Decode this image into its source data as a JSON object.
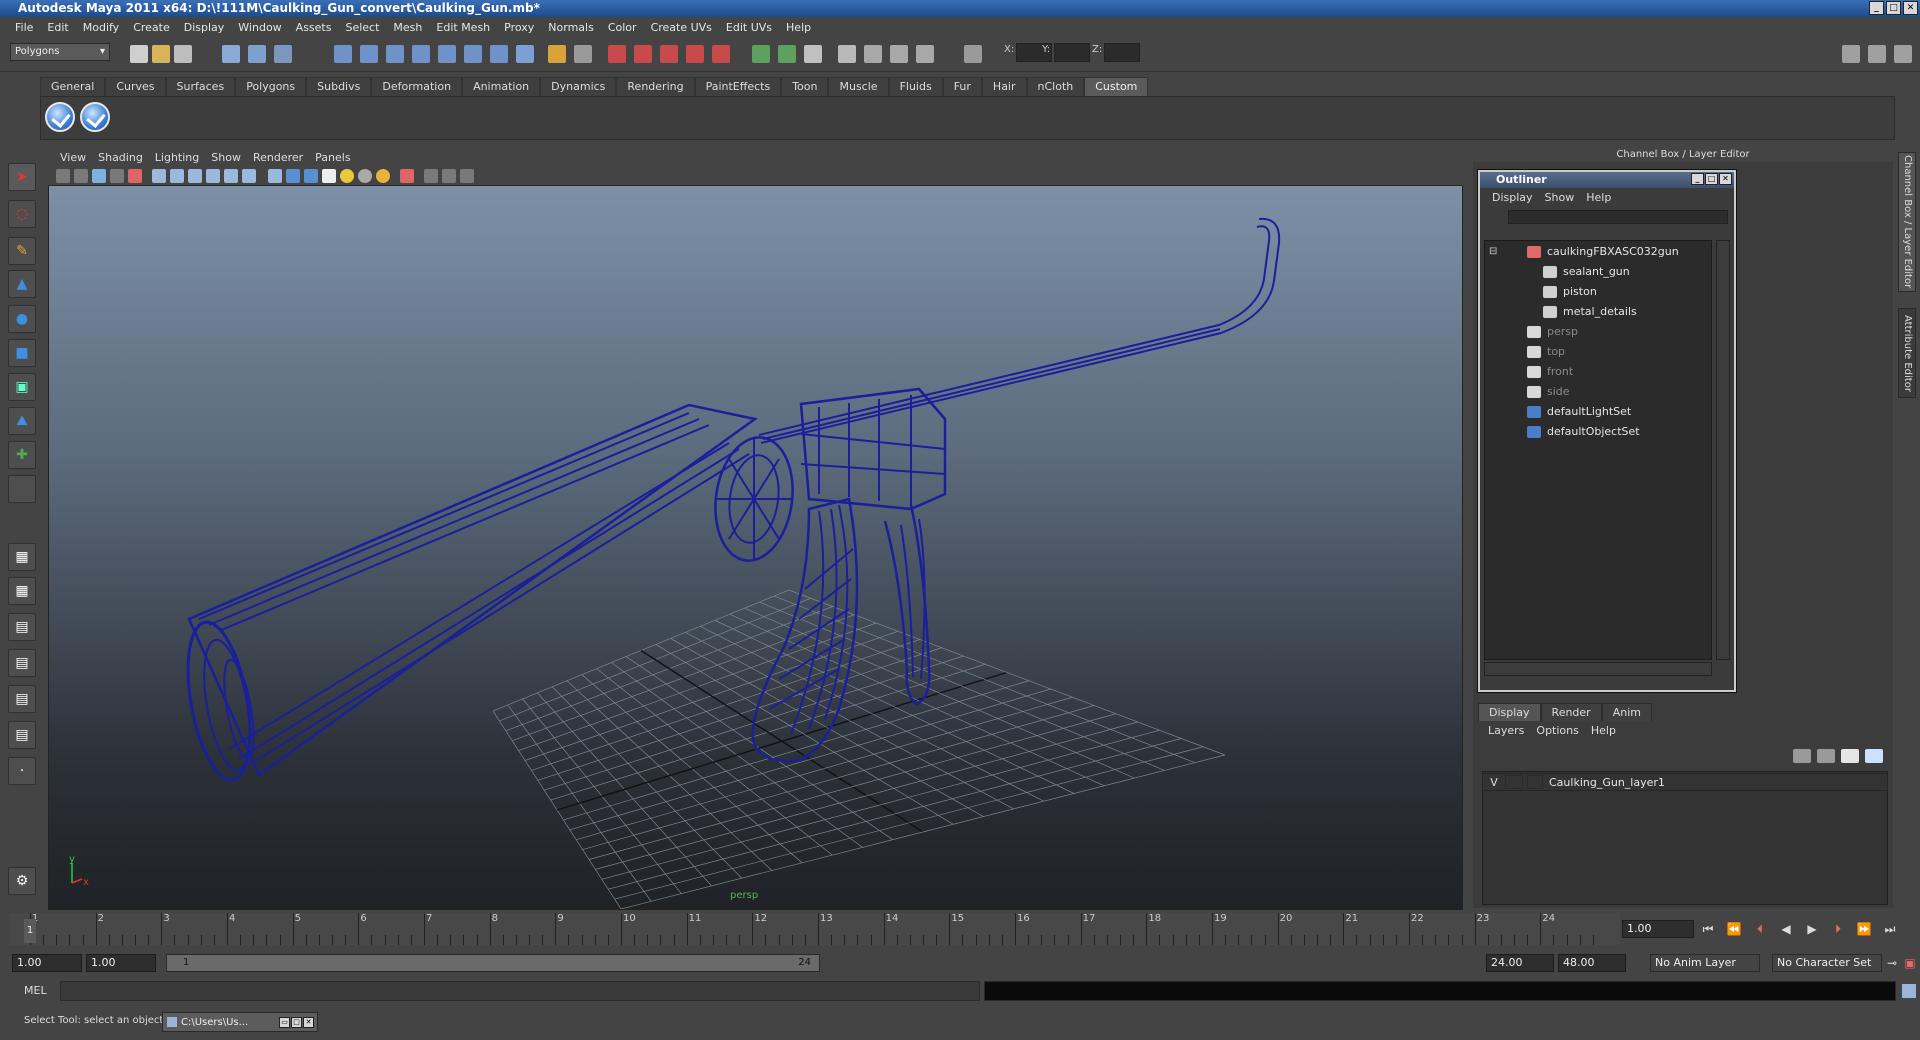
{
  "window": {
    "title": "Autodesk Maya 2011 x64: D:\\!111M\\Caulking_Gun_convert\\Caulking_Gun.mb*"
  },
  "menubar": [
    "File",
    "Edit",
    "Modify",
    "Create",
    "Display",
    "Window",
    "Assets",
    "Select",
    "Mesh",
    "Edit Mesh",
    "Proxy",
    "Normals",
    "Color",
    "Create UVs",
    "Edit UVs",
    "Help"
  ],
  "toolbar": {
    "mode": "Polygons",
    "x_label": "X:",
    "y_label": "Y:",
    "z_label": "Z:"
  },
  "shelf": {
    "tabs": [
      "General",
      "Curves",
      "Surfaces",
      "Polygons",
      "Subdivs",
      "Deformation",
      "Animation",
      "Dynamics",
      "Rendering",
      "PaintEffects",
      "Toon",
      "Muscle",
      "Fluids",
      "Fur",
      "Hair",
      "nCloth",
      "Custom"
    ],
    "active": "Custom"
  },
  "viewport": {
    "menu": [
      "View",
      "Shading",
      "Lighting",
      "Show",
      "Renderer",
      "Panels"
    ],
    "camera_label": "persp",
    "axis_y": "y",
    "axis_x": "x"
  },
  "right_panel": {
    "header": "Channel Box / Layer Editor",
    "side_tabs": [
      "Channel Box / Layer Editor",
      "Attribute Editor"
    ]
  },
  "outliner": {
    "title": "Outliner",
    "menu": [
      "Display",
      "Show",
      "Help"
    ],
    "items": [
      {
        "label": "caulkingFBXASC032gun",
        "indent": 0,
        "dim": false
      },
      {
        "label": "sealant_gun",
        "indent": 1,
        "dim": false
      },
      {
        "label": "piston",
        "indent": 1,
        "dim": false
      },
      {
        "label": "metal_details",
        "indent": 1,
        "dim": false
      },
      {
        "label": "persp",
        "indent": 0,
        "dim": true
      },
      {
        "label": "top",
        "indent": 0,
        "dim": true
      },
      {
        "label": "front",
        "indent": 0,
        "dim": true
      },
      {
        "label": "side",
        "indent": 0,
        "dim": true
      },
      {
        "label": "defaultLightSet",
        "indent": 0,
        "dim": false
      },
      {
        "label": "defaultObjectSet",
        "indent": 0,
        "dim": false
      }
    ]
  },
  "layer_editor": {
    "tabs": [
      "Display",
      "Render",
      "Anim"
    ],
    "active_tab": "Display",
    "menu": [
      "Layers",
      "Options",
      "Help"
    ],
    "layers": [
      {
        "visible": "V",
        "name": "Caulking_Gun_layer1"
      }
    ]
  },
  "timeline": {
    "ticks": [
      "1",
      "2",
      "3",
      "4",
      "5",
      "6",
      "7",
      "8",
      "9",
      "10",
      "11",
      "12",
      "13",
      "14",
      "15",
      "16",
      "17",
      "18",
      "19",
      "20",
      "21",
      "22",
      "23",
      "24"
    ],
    "current_frame": "1.00",
    "current_marker": "1"
  },
  "range": {
    "start": "1.00",
    "playback_start": "1.00",
    "slider_start": "1",
    "slider_end": "24",
    "playback_end": "24.00",
    "end": "48.00",
    "anim_layer": "No Anim Layer",
    "character_set": "No Character Set"
  },
  "command": {
    "label": "MEL"
  },
  "status": {
    "help_text": "Select Tool: select an object",
    "task_label": "C:\\Users\\Us..."
  }
}
